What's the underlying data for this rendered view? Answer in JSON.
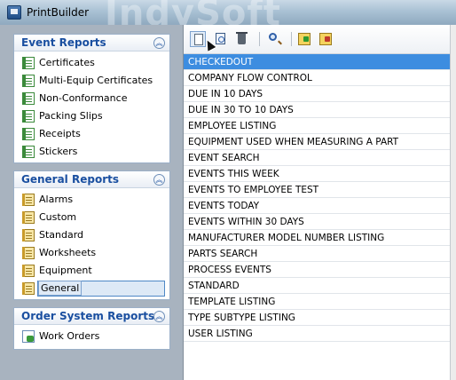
{
  "window": {
    "title": "PrintBuilder",
    "watermark": "IndySoft"
  },
  "sidebar": {
    "groups": [
      {
        "title": "Event Reports",
        "items": [
          {
            "label": "Certificates",
            "icon": "report-green-icon"
          },
          {
            "label": "Multi-Equip Certificates",
            "icon": "report-green-icon"
          },
          {
            "label": "Non-Conformance",
            "icon": "report-green-icon"
          },
          {
            "label": "Packing Slips",
            "icon": "report-green-icon"
          },
          {
            "label": "Receipts",
            "icon": "report-green-icon"
          },
          {
            "label": "Stickers",
            "icon": "report-green-icon"
          }
        ]
      },
      {
        "title": "General Reports",
        "items": [
          {
            "label": "Alarms",
            "icon": "report-yellow-icon"
          },
          {
            "label": "Custom",
            "icon": "report-yellow-icon"
          },
          {
            "label": "Standard",
            "icon": "report-yellow-icon"
          },
          {
            "label": "Worksheets",
            "icon": "report-yellow-icon"
          },
          {
            "label": "Equipment",
            "icon": "report-yellow-icon"
          },
          {
            "label": "General",
            "icon": "report-yellow-icon",
            "selected": true
          }
        ]
      },
      {
        "title": "Order System Reports",
        "items": [
          {
            "label": "Work Orders",
            "icon": "order-report-icon"
          }
        ]
      }
    ]
  },
  "toolbar": {
    "buttons": [
      "new-report-icon",
      "preview-icon",
      "delete-icon",
      "search-icon",
      "import-icon",
      "export-icon"
    ]
  },
  "reports": [
    "CHECKEDOUT",
    "COMPANY FLOW CONTROL",
    "DUE IN 10 DAYS",
    "DUE IN 30 TO 10 DAYS",
    "EMPLOYEE LISTING",
    "EQUIPMENT USED WHEN MEASURING A PART",
    "EVENT SEARCH",
    "EVENTS THIS WEEK",
    "EVENTS TO EMPLOYEE TEST",
    "EVENTS TODAY",
    "EVENTS WITHIN 30 DAYS",
    "MANUFACTURER MODEL NUMBER LISTING",
    "PARTS SEARCH",
    "PROCESS EVENTS",
    "STANDARD",
    "TEMPLATE LISTING",
    "TYPE SUBTYPE LISTING",
    "USER LISTING"
  ],
  "selected_report": "CHECKEDOUT",
  "colors": {
    "accent": "#1a4fa0",
    "selection": "#3d8de0"
  }
}
